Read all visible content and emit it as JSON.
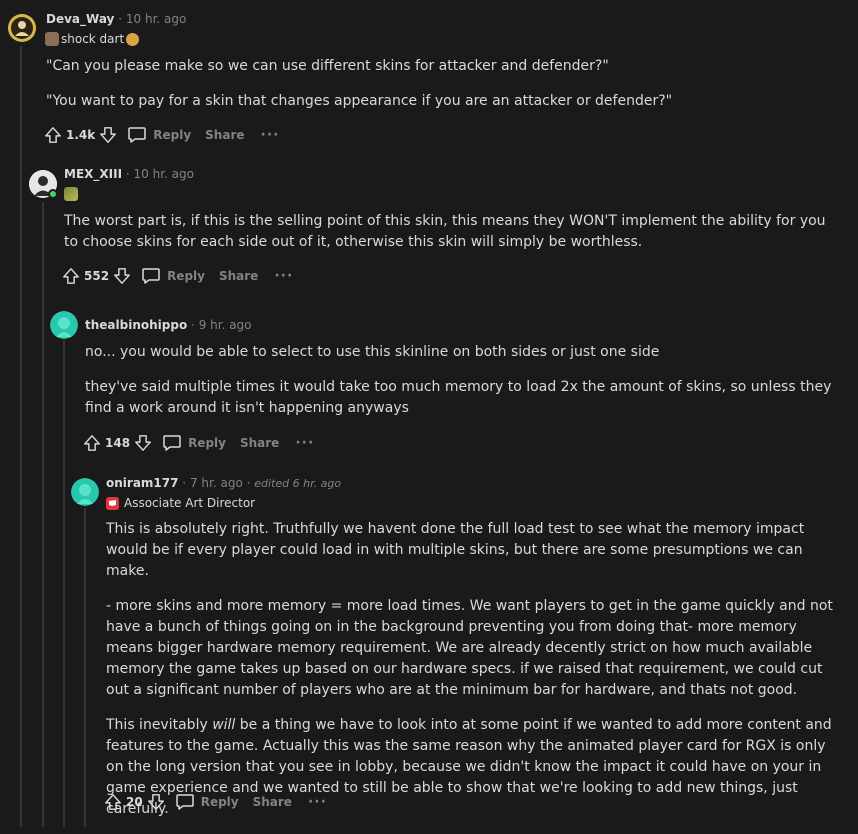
{
  "comments": [
    {
      "username": "Deva_Way",
      "time": "10 hr. ago",
      "flair": "shock dart",
      "paragraphs": [
        "\"Can you please make so we can use different skins for attacker and defender?\"",
        "\"You want to pay for a skin that changes appearance if you are an attacker or defender?\""
      ],
      "votes": "1.4k",
      "reply_label": "Reply",
      "share_label": "Share",
      "more_label": "···"
    },
    {
      "username": "MEX_XIII",
      "time": "10 hr. ago",
      "paragraphs": [
        "The worst part is, if this is the selling point of this skin, this means they WON'T implement the ability for you to choose skins for each side out of it, otherwise this skin will simply be worthless."
      ],
      "votes": "552",
      "reply_label": "Reply",
      "share_label": "Share",
      "more_label": "···"
    },
    {
      "username": "thealbinohippo",
      "time": "9 hr. ago",
      "paragraphs": [
        "no... you would be able to select to use this skinline on both sides or just one side",
        "they've said multiple times it would take too much memory to load 2x the amount of skins, so unless they find a work around it isn't happening anyways"
      ],
      "votes": "148",
      "reply_label": "Reply",
      "share_label": "Share",
      "more_label": "···"
    },
    {
      "username": "oniram177",
      "time": "7 hr. ago",
      "edited": "edited 6 hr. ago",
      "flair": "Associate Art Director",
      "paragraphs": [
        "This is absolutely right. Truthfully we havent done the full load test to see what the memory impact would be if every player could load in with multiple skins, but there are some presumptions we can make.",
        "- more skins and more memory = more load times. We want players to get in the game quickly and not have a bunch of things going on in the background preventing you from doing that- more memory means bigger hardware memory requirement. We are already decently strict on how much available memory the game takes up based on our hardware specs. if we raised that requirement, we could cut out a significant number of players who are at the minimum bar for hardware, and thats not good."
      ],
      "p3_before": "This inevitably ",
      "p3_em": "will",
      "p3_after": " be a thing we have to look into at some point if we wanted to add more content and features to the game. Actually this was the same reason why the animated player card for RGX is only on the long version that you see in lobby, because we didn't know the impact it could have on your in game experience and we wanted to still be able to show that we're looking to add new things, just carefully.",
      "votes": "20",
      "reply_label": "Reply",
      "share_label": "Share",
      "more_label": "···"
    }
  ],
  "separator": "·",
  "colors": {
    "background": "#1a1a1b",
    "text": "#d7dadc",
    "muted": "#818384",
    "thread_line": "#343536",
    "online": "#46d160",
    "avatar_teal": "#29c7ac",
    "flair_red": "#e0383e"
  }
}
